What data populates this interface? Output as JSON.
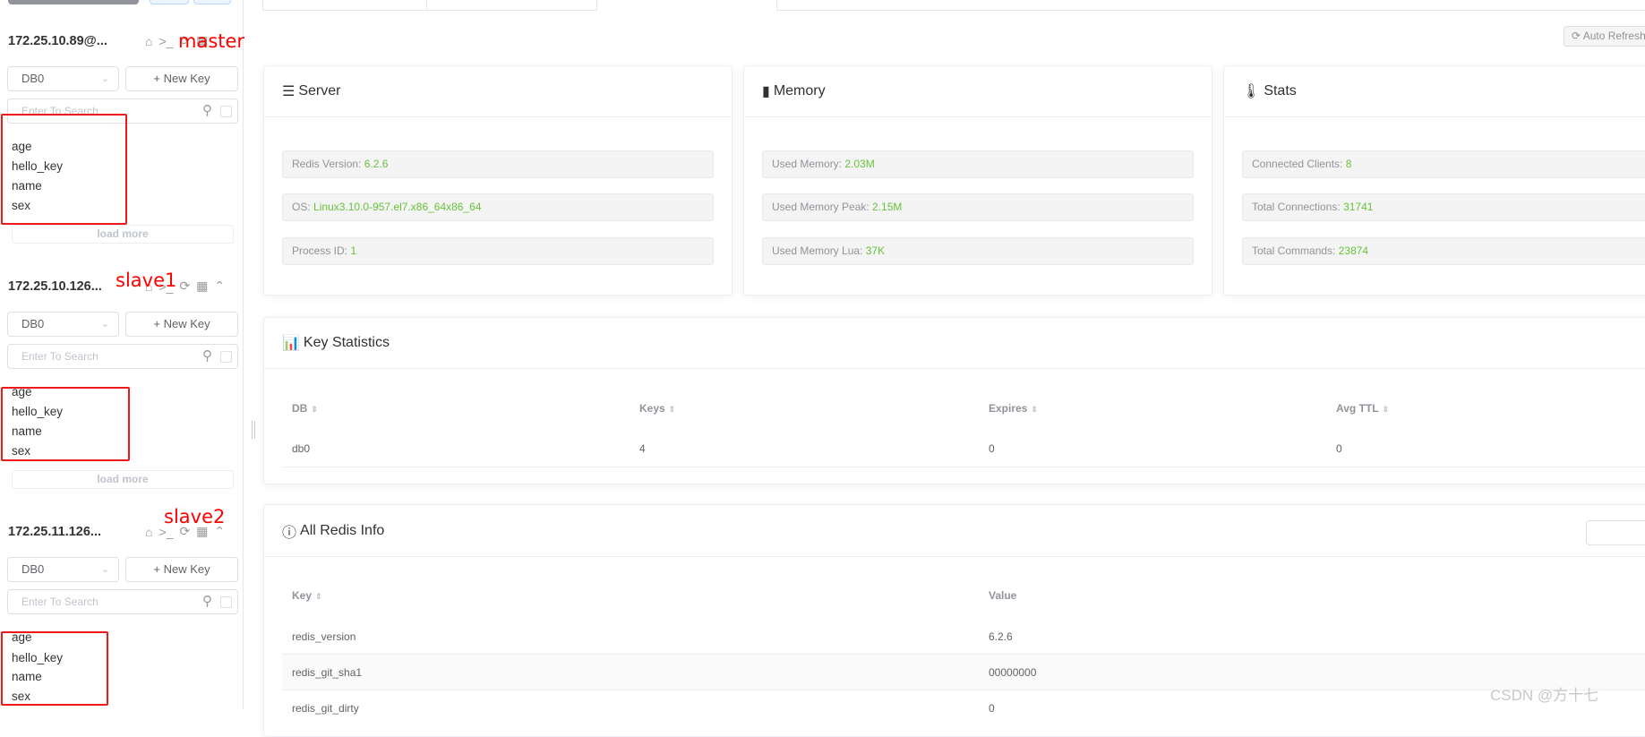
{
  "sidebar": {
    "connections": [
      {
        "title": "172.25.10.89@...",
        "annotation": "master",
        "db": "DB0",
        "new_key": "+ New Key",
        "search_placeholder": "Enter To Search",
        "keys": [
          "age",
          "hello_key",
          "name",
          "sex"
        ],
        "load_more": "load more"
      },
      {
        "title": "172.25.10.126...",
        "annotation": "slave1",
        "db": "DB0",
        "new_key": "+ New Key",
        "search_placeholder": "Enter To Search",
        "keys": [
          "age",
          "hello_key",
          "name",
          "sex"
        ],
        "load_more": "load more"
      },
      {
        "title": "172.25.11.126...",
        "annotation": "slave2",
        "db": "DB0",
        "new_key": "+ New Key",
        "search_placeholder": "Enter To Search",
        "keys": [
          "age",
          "hello_key",
          "name",
          "sex"
        ]
      }
    ]
  },
  "toolbar": {
    "auto_refresh": "Auto Refresh"
  },
  "server": {
    "title": "Server",
    "items": [
      {
        "label": "Redis Version:",
        "value": "6.2.6"
      },
      {
        "label": "OS:",
        "value": "Linux3.10.0-957.el7.x86_64x86_64"
      },
      {
        "label": "Process ID:",
        "value": "1"
      }
    ]
  },
  "memory": {
    "title": "Memory",
    "items": [
      {
        "label": "Used Memory:",
        "value": "2.03M"
      },
      {
        "label": "Used Memory Peak:",
        "value": "2.15M"
      },
      {
        "label": "Used Memory Lua:",
        "value": "37K"
      }
    ]
  },
  "stats": {
    "title": "Stats",
    "items": [
      {
        "label": "Connected Clients:",
        "value": "8"
      },
      {
        "label": "Total Connections:",
        "value": "31741"
      },
      {
        "label": "Total Commands:",
        "value": "23874"
      }
    ]
  },
  "key_statistics": {
    "title": "Key Statistics",
    "columns": [
      "DB",
      "Keys",
      "Expires",
      "Avg TTL"
    ],
    "rows": [
      [
        "db0",
        "4",
        "0",
        "0"
      ]
    ]
  },
  "all_info": {
    "title": "All Redis Info",
    "columns": [
      "Key",
      "Value"
    ],
    "rows": [
      [
        "redis_version",
        "6.2.6"
      ],
      [
        "redis_git_sha1",
        "00000000"
      ],
      [
        "redis_git_dirty",
        "0"
      ]
    ]
  },
  "watermark": "CSDN @方十七",
  "colors": {
    "value_green": "#67c23a",
    "annotation_red": "#ff0000"
  }
}
